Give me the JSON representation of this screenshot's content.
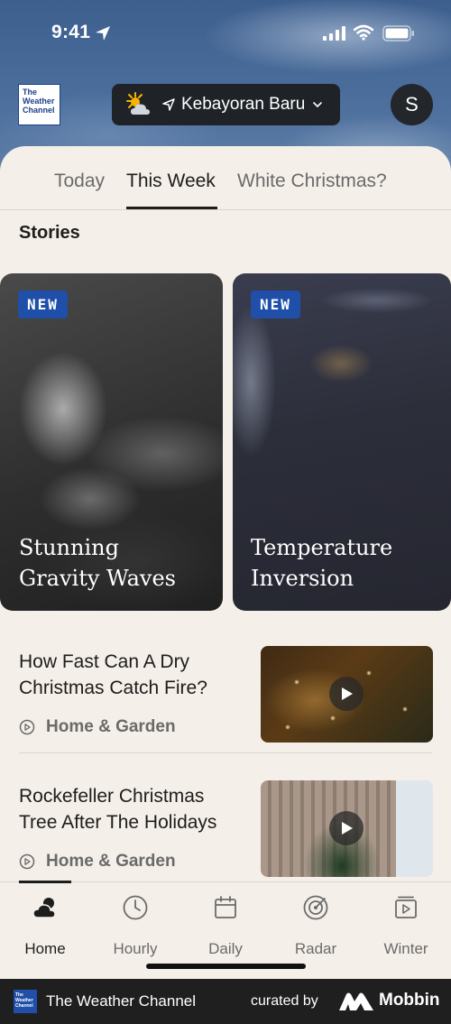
{
  "status_bar": {
    "time": "9:41"
  },
  "header": {
    "logo_lines": [
      "The",
      "Weather",
      "Channel"
    ],
    "location": "Kebayoran Baru",
    "avatar_initial": "S"
  },
  "tabs": [
    {
      "label": "Today",
      "active": false
    },
    {
      "label": "This Week",
      "active": true
    },
    {
      "label": "White Christmas?",
      "active": false
    }
  ],
  "stories_section": {
    "title": "Stories",
    "cards": [
      {
        "badge": "NEW",
        "title_line1": "Stunning",
        "title_line2": "Gravity Waves"
      },
      {
        "badge": "NEW",
        "title_line1": "Temperature",
        "title_line2": "Inversion"
      }
    ]
  },
  "articles": [
    {
      "headline": "How Fast Can A Dry Christmas Catch Fire?",
      "category": "Home & Garden",
      "thumbnail_icon": "play-icon"
    },
    {
      "headline": "Rockefeller Christmas Tree After The Holidays",
      "category": "Home & Garden",
      "thumbnail_icon": "play-icon"
    }
  ],
  "tab_bar": [
    {
      "label": "Home",
      "icon": "cloud-sun-icon",
      "active": true
    },
    {
      "label": "Hourly",
      "icon": "clock-icon",
      "active": false
    },
    {
      "label": "Daily",
      "icon": "calendar-icon",
      "active": false
    },
    {
      "label": "Radar",
      "icon": "radar-icon",
      "active": false
    },
    {
      "label": "Winter",
      "icon": "video-icon",
      "active": false
    }
  ],
  "footer": {
    "brand": "The Weather Channel",
    "mini_logo_lines": [
      "The",
      "Weather",
      "Channel"
    ],
    "curated_by": "curated by",
    "mobbin": "Mobbin"
  },
  "colors": {
    "accent_blue": "#1f4fa8",
    "sheet_bg": "#f4efe8",
    "dark": "#1f2328"
  }
}
